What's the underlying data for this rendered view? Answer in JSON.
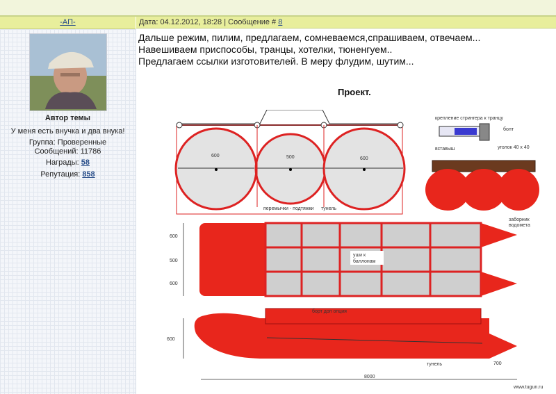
{
  "author_link": "-АП-",
  "post_meta_prefix": "Дата: 04.12.2012, 18:28 | Сообщение # ",
  "post_number": "8",
  "author": {
    "role": "Автор темы",
    "status": "У меня есть внучка и два внука!",
    "group": "Группа: Проверенные",
    "messages": "Сообщений: 11786",
    "awards_label": "Награды: ",
    "awards_value": "58",
    "reputation_label": "Репутация: ",
    "reputation_value": "858"
  },
  "message_lines": [
    "Дальше режим, пилим, предлагаем, сомневаемся,спрашиваем, отвечаем...",
    "Навешиваем приспособы, транцы, хотелки, тюненгуем..",
    "Предлагаем ссылки изготовителей. В меру флудим, шутим..."
  ],
  "project_title": "Проект.",
  "drawing_labels": {
    "d1": "600",
    "d2": "500",
    "d3": "600",
    "bridges": "перемычки - подтяжки",
    "tunnel": "тунель",
    "stringer": "крепление стрингера к транцу",
    "bolt": "болт",
    "insert": "вставыш",
    "angle": "уголок 40 х 40",
    "intake": "заборник",
    "intake2": "водомета",
    "ears": "уши к",
    "ears2": "баллонам",
    "w600a": "600",
    "w500": "500",
    "w600b": "600",
    "side": "борт доп опция",
    "h600": "600",
    "tunnel2": "тунель",
    "len": "8000",
    "nose": "700",
    "watermark": "www.tugun.ru"
  },
  "colors": {
    "header": "#e8ee9c",
    "link": "#2a4f8a",
    "red": "#e8261c"
  }
}
